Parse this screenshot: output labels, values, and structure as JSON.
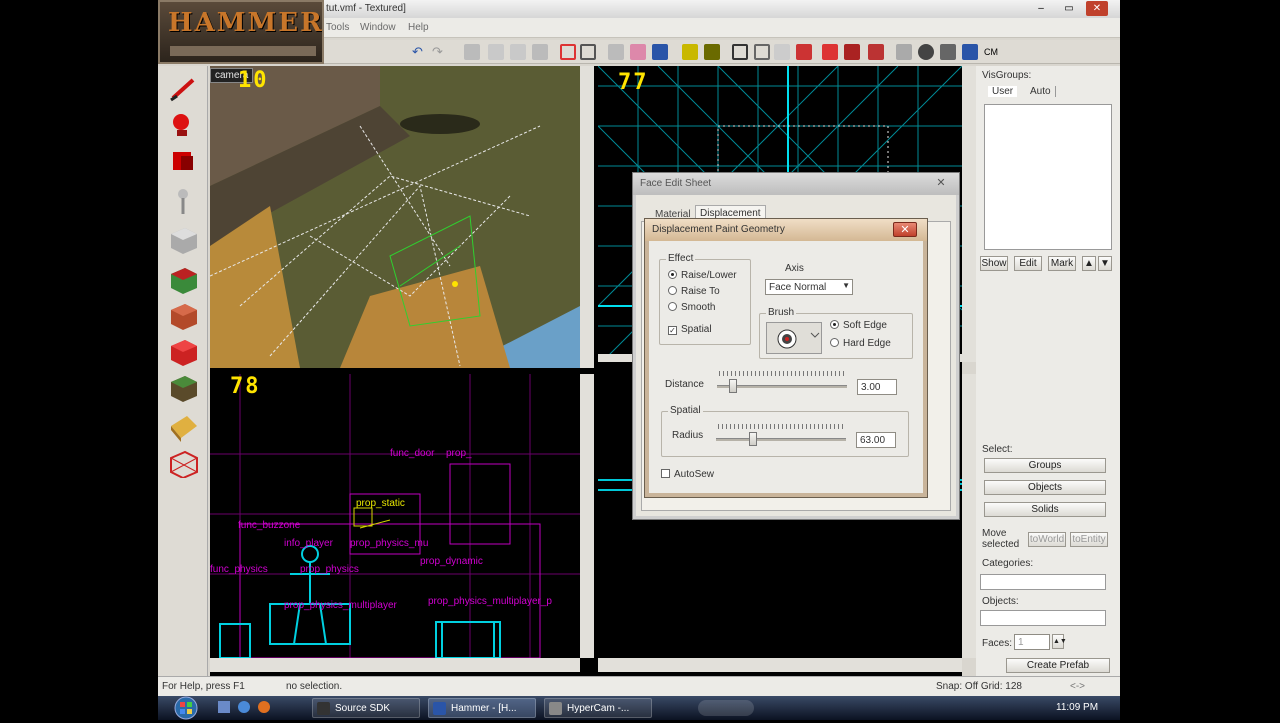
{
  "app": {
    "title": "tut.vmf - Textured]",
    "logo": "HAMMER",
    "menus": [
      "Tools",
      "Window",
      "Help"
    ]
  },
  "viewports": {
    "camera_label": "camera",
    "top_left_label": "10",
    "top_right_label": "77",
    "bottom_left_label": "78",
    "entities": [
      "func_door",
      "prop_",
      "prop_static",
      "func_buzzone",
      "info_player",
      "prop_physics_mu",
      "prop_dynamic",
      "func_physics",
      "prop_physics",
      "prop_physics_multiplayer",
      "prop_physics_multiplayer_p"
    ]
  },
  "face_edit": {
    "title": "Face Edit Sheet",
    "tabs": [
      "Material",
      "Displacement"
    ]
  },
  "disp_paint": {
    "title": "Displacement Paint Geometry",
    "effect_label": "Effect",
    "effect_options": [
      "Raise/Lower",
      "Raise To",
      "Smooth"
    ],
    "effect_selected": "Raise/Lower",
    "spatial_check": "Spatial",
    "axis_label": "Axis",
    "axis_value": "Face Normal",
    "brush_label": "Brush",
    "brush_options": [
      "Soft Edge",
      "Hard Edge"
    ],
    "distance_label": "Distance",
    "distance_value": "3.00",
    "distance_level": 0.1,
    "spatial_group": "Spatial",
    "radius_label": "Radius",
    "radius_value": "63.00",
    "radius_level": 0.27,
    "autosew_label": "AutoSew"
  },
  "right_panel": {
    "visgroups_label": "VisGroups:",
    "tabs": [
      "User",
      "Auto"
    ],
    "buttons": [
      "Show",
      "Edit",
      "Mark"
    ],
    "select_label": "Select:",
    "select_buttons": [
      "Groups",
      "Objects",
      "Solids"
    ],
    "move_selected_label": "Move selected",
    "move_buttons": [
      "toWorld",
      "toEntity"
    ],
    "categories_label": "Categories:",
    "objects_label": "Objects:",
    "faces_label": "Faces:",
    "faces_value": "1",
    "create_prefab": "Create Prefab"
  },
  "status": {
    "help": "For Help, press F1",
    "selection": "no selection.",
    "snap": "Snap: Off Grid: 128"
  },
  "taskbar": {
    "items": [
      "Source SDK",
      "Hammer - [H...",
      "HyperCam -..."
    ],
    "clock": "11:09 PM"
  },
  "colors": {
    "viewport_bg": "#000000",
    "grid_cyan": "#00c8d8",
    "entity_magenta": "#d200d2",
    "label_yellow": "#ffe400"
  }
}
